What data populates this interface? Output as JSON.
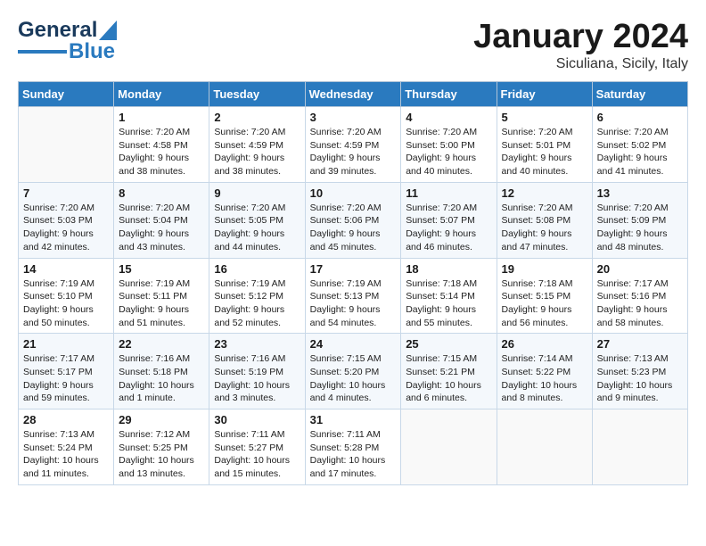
{
  "header": {
    "logo_line1": "General",
    "logo_line2": "Blue",
    "month": "January 2024",
    "location": "Siculiana, Sicily, Italy"
  },
  "weekdays": [
    "Sunday",
    "Monday",
    "Tuesday",
    "Wednesday",
    "Thursday",
    "Friday",
    "Saturday"
  ],
  "weeks": [
    [
      {
        "num": "",
        "info": ""
      },
      {
        "num": "1",
        "info": "Sunrise: 7:20 AM\nSunset: 4:58 PM\nDaylight: 9 hours\nand 38 minutes."
      },
      {
        "num": "2",
        "info": "Sunrise: 7:20 AM\nSunset: 4:59 PM\nDaylight: 9 hours\nand 38 minutes."
      },
      {
        "num": "3",
        "info": "Sunrise: 7:20 AM\nSunset: 4:59 PM\nDaylight: 9 hours\nand 39 minutes."
      },
      {
        "num": "4",
        "info": "Sunrise: 7:20 AM\nSunset: 5:00 PM\nDaylight: 9 hours\nand 40 minutes."
      },
      {
        "num": "5",
        "info": "Sunrise: 7:20 AM\nSunset: 5:01 PM\nDaylight: 9 hours\nand 40 minutes."
      },
      {
        "num": "6",
        "info": "Sunrise: 7:20 AM\nSunset: 5:02 PM\nDaylight: 9 hours\nand 41 minutes."
      }
    ],
    [
      {
        "num": "7",
        "info": "Sunrise: 7:20 AM\nSunset: 5:03 PM\nDaylight: 9 hours\nand 42 minutes."
      },
      {
        "num": "8",
        "info": "Sunrise: 7:20 AM\nSunset: 5:04 PM\nDaylight: 9 hours\nand 43 minutes."
      },
      {
        "num": "9",
        "info": "Sunrise: 7:20 AM\nSunset: 5:05 PM\nDaylight: 9 hours\nand 44 minutes."
      },
      {
        "num": "10",
        "info": "Sunrise: 7:20 AM\nSunset: 5:06 PM\nDaylight: 9 hours\nand 45 minutes."
      },
      {
        "num": "11",
        "info": "Sunrise: 7:20 AM\nSunset: 5:07 PM\nDaylight: 9 hours\nand 46 minutes."
      },
      {
        "num": "12",
        "info": "Sunrise: 7:20 AM\nSunset: 5:08 PM\nDaylight: 9 hours\nand 47 minutes."
      },
      {
        "num": "13",
        "info": "Sunrise: 7:20 AM\nSunset: 5:09 PM\nDaylight: 9 hours\nand 48 minutes."
      }
    ],
    [
      {
        "num": "14",
        "info": "Sunrise: 7:19 AM\nSunset: 5:10 PM\nDaylight: 9 hours\nand 50 minutes."
      },
      {
        "num": "15",
        "info": "Sunrise: 7:19 AM\nSunset: 5:11 PM\nDaylight: 9 hours\nand 51 minutes."
      },
      {
        "num": "16",
        "info": "Sunrise: 7:19 AM\nSunset: 5:12 PM\nDaylight: 9 hours\nand 52 minutes."
      },
      {
        "num": "17",
        "info": "Sunrise: 7:19 AM\nSunset: 5:13 PM\nDaylight: 9 hours\nand 54 minutes."
      },
      {
        "num": "18",
        "info": "Sunrise: 7:18 AM\nSunset: 5:14 PM\nDaylight: 9 hours\nand 55 minutes."
      },
      {
        "num": "19",
        "info": "Sunrise: 7:18 AM\nSunset: 5:15 PM\nDaylight: 9 hours\nand 56 minutes."
      },
      {
        "num": "20",
        "info": "Sunrise: 7:17 AM\nSunset: 5:16 PM\nDaylight: 9 hours\nand 58 minutes."
      }
    ],
    [
      {
        "num": "21",
        "info": "Sunrise: 7:17 AM\nSunset: 5:17 PM\nDaylight: 9 hours\nand 59 minutes."
      },
      {
        "num": "22",
        "info": "Sunrise: 7:16 AM\nSunset: 5:18 PM\nDaylight: 10 hours\nand 1 minute."
      },
      {
        "num": "23",
        "info": "Sunrise: 7:16 AM\nSunset: 5:19 PM\nDaylight: 10 hours\nand 3 minutes."
      },
      {
        "num": "24",
        "info": "Sunrise: 7:15 AM\nSunset: 5:20 PM\nDaylight: 10 hours\nand 4 minutes."
      },
      {
        "num": "25",
        "info": "Sunrise: 7:15 AM\nSunset: 5:21 PM\nDaylight: 10 hours\nand 6 minutes."
      },
      {
        "num": "26",
        "info": "Sunrise: 7:14 AM\nSunset: 5:22 PM\nDaylight: 10 hours\nand 8 minutes."
      },
      {
        "num": "27",
        "info": "Sunrise: 7:13 AM\nSunset: 5:23 PM\nDaylight: 10 hours\nand 9 minutes."
      }
    ],
    [
      {
        "num": "28",
        "info": "Sunrise: 7:13 AM\nSunset: 5:24 PM\nDaylight: 10 hours\nand 11 minutes."
      },
      {
        "num": "29",
        "info": "Sunrise: 7:12 AM\nSunset: 5:25 PM\nDaylight: 10 hours\nand 13 minutes."
      },
      {
        "num": "30",
        "info": "Sunrise: 7:11 AM\nSunset: 5:27 PM\nDaylight: 10 hours\nand 15 minutes."
      },
      {
        "num": "31",
        "info": "Sunrise: 7:11 AM\nSunset: 5:28 PM\nDaylight: 10 hours\nand 17 minutes."
      },
      {
        "num": "",
        "info": ""
      },
      {
        "num": "",
        "info": ""
      },
      {
        "num": "",
        "info": ""
      }
    ]
  ]
}
